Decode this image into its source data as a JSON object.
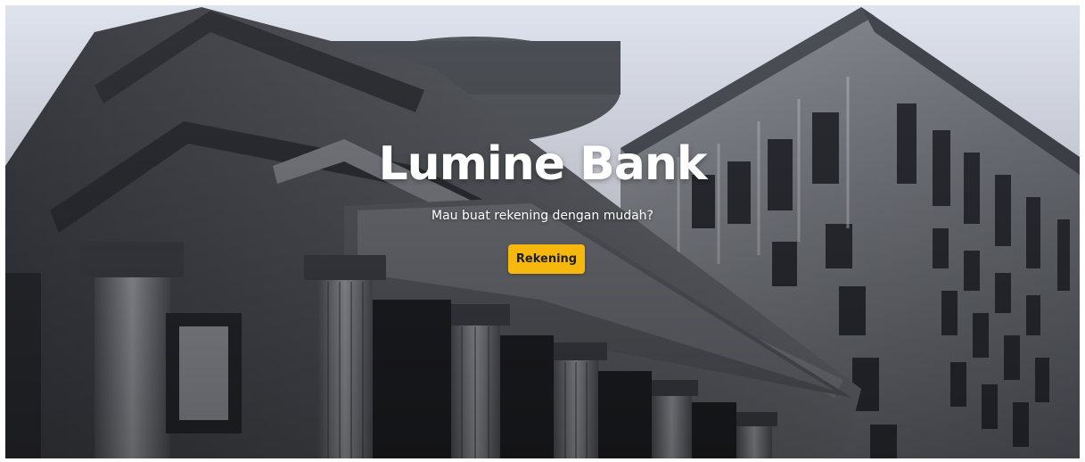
{
  "hero": {
    "title": "Lumine Bank",
    "subtitle": "Mau buat rekening dengan mudah?",
    "cta_label": "Rekening"
  },
  "colors": {
    "sky": "#dfe3ee",
    "cta_background": "#f7b80e",
    "title_text": "#ffffff"
  }
}
